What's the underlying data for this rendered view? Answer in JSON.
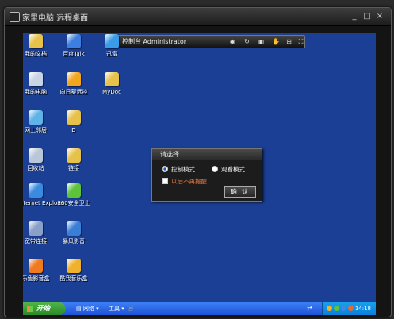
{
  "window": {
    "title": "家里电脑 远程桌面",
    "controls": [
      "_",
      "□",
      "×"
    ]
  },
  "remote_toolbar": {
    "label": "控制台 Administrator",
    "icons": [
      "eye-icon",
      "rotate-icon",
      "folder-icon",
      "hand-icon",
      "fit-window-icon",
      "fullscreen-icon"
    ]
  },
  "desktop_icons": [
    {
      "id": "my-documents",
      "label": "我的文档",
      "icon": "folder-document-icon",
      "color": "#e7c24a"
    },
    {
      "id": "baidu-talk",
      "label": "百度Talk",
      "icon": "baidu-talk-icon",
      "color": "#3d7fe0"
    },
    {
      "id": "xunlei",
      "label": "迅雷",
      "icon": "thunder-icon",
      "color": "#3a9be6"
    },
    {
      "id": "my-computer",
      "label": "我的电脑",
      "icon": "computer-icon",
      "color": "#c9d3e6"
    },
    {
      "id": "sunflower",
      "label": "向日葵远控",
      "icon": "sunflower-icon",
      "color": "#f2a51f"
    },
    {
      "id": "mydoc",
      "label": "MyDoc",
      "icon": "folder-icon",
      "color": "#e7c24a"
    },
    {
      "id": "network",
      "label": "网上邻居",
      "icon": "network-icon",
      "color": "#5fb3e8"
    },
    {
      "id": "d-drive",
      "label": "D",
      "icon": "folder-icon",
      "color": "#e7c24a"
    },
    {
      "id": "recycle-bin",
      "label": "回收站",
      "icon": "recycle-bin-icon",
      "color": "#b9c7d8"
    },
    {
      "id": "links",
      "label": "链接",
      "icon": "folder-icon",
      "color": "#e7c24a"
    },
    {
      "id": "ie",
      "label": "Internet Explorer",
      "icon": "ie-icon",
      "color": "#3a8be0"
    },
    {
      "id": "360",
      "label": "360安全卫士",
      "icon": "shield-icon",
      "color": "#5cc33a"
    },
    {
      "id": "broadband",
      "label": "宽带连接",
      "icon": "broadband-icon",
      "color": "#8aa0c8"
    },
    {
      "id": "baofeng",
      "label": "暴风影音",
      "icon": "baofeng-icon",
      "color": "#3a7fd6"
    },
    {
      "id": "leyu",
      "label": "乐鱼影音盒",
      "icon": "fish-icon",
      "color": "#f07a20"
    },
    {
      "id": "kuwo",
      "label": "酷我音乐盒",
      "icon": "music-icon",
      "color": "#f0b22c"
    }
  ],
  "dialog": {
    "title": "请选择",
    "option_control": "控制模式",
    "option_watch": "观看模式",
    "selected": "控制模式",
    "dont_remind": "以后不再提醒",
    "ok": "确 认"
  },
  "taskbar": {
    "start": "开始",
    "network": "网络",
    "tools": "工具",
    "clock": "14:18"
  },
  "colors": {
    "desktop": "#1a3f94",
    "taskbar": "#2560e0",
    "start": "#3a9e36",
    "warning_text": "#e8733a"
  }
}
